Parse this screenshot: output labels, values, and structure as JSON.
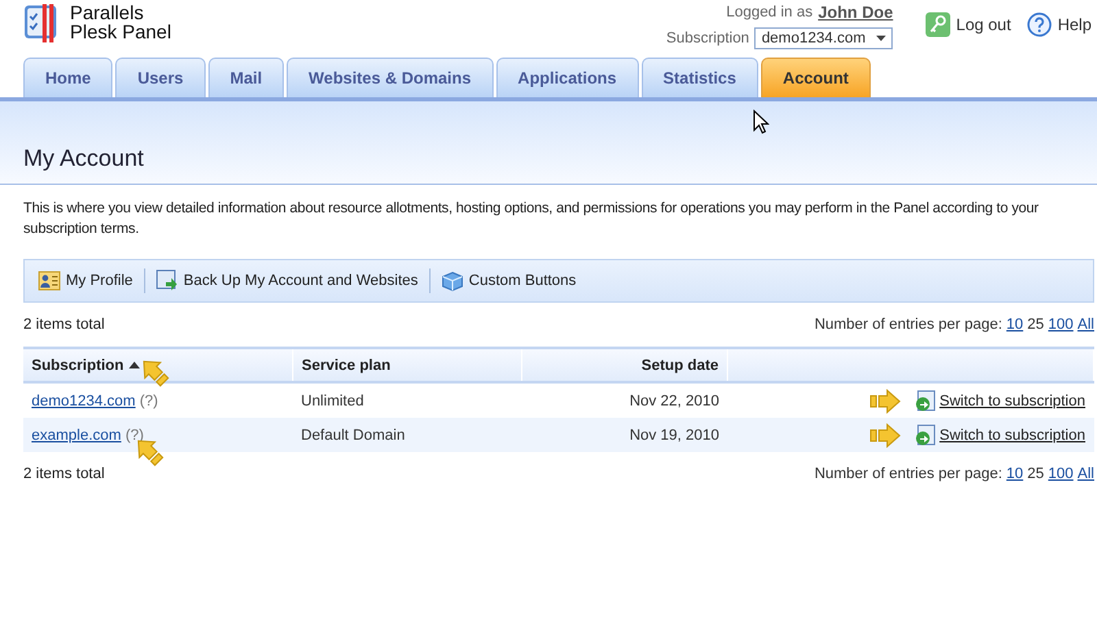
{
  "brand": {
    "line1": "Parallels",
    "line2": "Plesk Panel"
  },
  "user": {
    "prefix": "Logged in as",
    "name": "John Doe",
    "subscription_label": "Subscription",
    "subscription_value": "demo1234.com",
    "logout": "Log out",
    "help": "Help"
  },
  "tabs": [
    {
      "label": "Home",
      "selected": false
    },
    {
      "label": "Users",
      "selected": false
    },
    {
      "label": "Mail",
      "selected": false
    },
    {
      "label": "Websites & Domains",
      "selected": false
    },
    {
      "label": "Applications",
      "selected": false
    },
    {
      "label": "Statistics",
      "selected": false
    },
    {
      "label": "Account",
      "selected": true
    }
  ],
  "page_title": "My Account",
  "description": "This is where you view detailed information about resource allotments, hosting options, and permissions for operations you may perform in the Panel according to your subscription terms.",
  "toolbar": [
    {
      "kind": "profile",
      "label": "My Profile"
    },
    {
      "kind": "backup",
      "label": "Back Up My Account and Websites"
    },
    {
      "kind": "custom",
      "label": "Custom Buttons"
    }
  ],
  "total_top": "2 items total",
  "pager_top": {
    "label": "Number of entries per page:",
    "options": [
      {
        "label": "10",
        "selected": false
      },
      {
        "label": "25",
        "selected": true
      },
      {
        "label": "100",
        "selected": false
      },
      {
        "label": "All",
        "selected": false
      }
    ]
  },
  "table": {
    "columns": [
      {
        "label": "Subscription",
        "sorted": true
      },
      {
        "label": "Service plan",
        "sorted": false
      },
      {
        "label": "Setup date",
        "sorted": false
      }
    ],
    "rows": [
      {
        "subscription": "demo1234.com",
        "hint": "(?)",
        "plan": "Unlimited",
        "date": "Nov 22, 2010",
        "action": "Switch to subscription"
      },
      {
        "subscription": "example.com",
        "hint": "(?)",
        "plan": "Default Domain",
        "date": "Nov 19, 2010",
        "action": "Switch to subscription"
      }
    ]
  },
  "total_bottom": "2 items total",
  "pager_bottom": {
    "label": "Number of entries per page:",
    "options": [
      {
        "label": "10",
        "selected": false
      },
      {
        "label": "25",
        "selected": true
      },
      {
        "label": "100",
        "selected": false
      },
      {
        "label": "All",
        "selected": false
      }
    ]
  }
}
